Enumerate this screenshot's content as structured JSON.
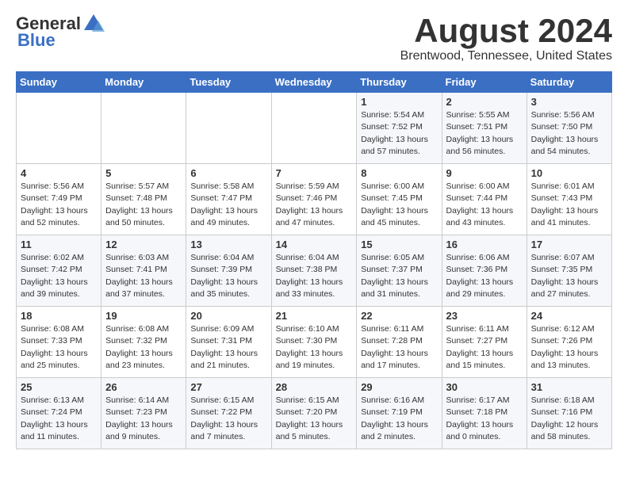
{
  "logo": {
    "general": "General",
    "blue": "Blue"
  },
  "header": {
    "title": "August 2024",
    "subtitle": "Brentwood, Tennessee, United States"
  },
  "weekdays": [
    "Sunday",
    "Monday",
    "Tuesday",
    "Wednesday",
    "Thursday",
    "Friday",
    "Saturday"
  ],
  "weeks": [
    [
      {
        "day": "",
        "detail": ""
      },
      {
        "day": "",
        "detail": ""
      },
      {
        "day": "",
        "detail": ""
      },
      {
        "day": "",
        "detail": ""
      },
      {
        "day": "1",
        "detail": "Sunrise: 5:54 AM\nSunset: 7:52 PM\nDaylight: 13 hours\nand 57 minutes."
      },
      {
        "day": "2",
        "detail": "Sunrise: 5:55 AM\nSunset: 7:51 PM\nDaylight: 13 hours\nand 56 minutes."
      },
      {
        "day": "3",
        "detail": "Sunrise: 5:56 AM\nSunset: 7:50 PM\nDaylight: 13 hours\nand 54 minutes."
      }
    ],
    [
      {
        "day": "4",
        "detail": "Sunrise: 5:56 AM\nSunset: 7:49 PM\nDaylight: 13 hours\nand 52 minutes."
      },
      {
        "day": "5",
        "detail": "Sunrise: 5:57 AM\nSunset: 7:48 PM\nDaylight: 13 hours\nand 50 minutes."
      },
      {
        "day": "6",
        "detail": "Sunrise: 5:58 AM\nSunset: 7:47 PM\nDaylight: 13 hours\nand 49 minutes."
      },
      {
        "day": "7",
        "detail": "Sunrise: 5:59 AM\nSunset: 7:46 PM\nDaylight: 13 hours\nand 47 minutes."
      },
      {
        "day": "8",
        "detail": "Sunrise: 6:00 AM\nSunset: 7:45 PM\nDaylight: 13 hours\nand 45 minutes."
      },
      {
        "day": "9",
        "detail": "Sunrise: 6:00 AM\nSunset: 7:44 PM\nDaylight: 13 hours\nand 43 minutes."
      },
      {
        "day": "10",
        "detail": "Sunrise: 6:01 AM\nSunset: 7:43 PM\nDaylight: 13 hours\nand 41 minutes."
      }
    ],
    [
      {
        "day": "11",
        "detail": "Sunrise: 6:02 AM\nSunset: 7:42 PM\nDaylight: 13 hours\nand 39 minutes."
      },
      {
        "day": "12",
        "detail": "Sunrise: 6:03 AM\nSunset: 7:41 PM\nDaylight: 13 hours\nand 37 minutes."
      },
      {
        "day": "13",
        "detail": "Sunrise: 6:04 AM\nSunset: 7:39 PM\nDaylight: 13 hours\nand 35 minutes."
      },
      {
        "day": "14",
        "detail": "Sunrise: 6:04 AM\nSunset: 7:38 PM\nDaylight: 13 hours\nand 33 minutes."
      },
      {
        "day": "15",
        "detail": "Sunrise: 6:05 AM\nSunset: 7:37 PM\nDaylight: 13 hours\nand 31 minutes."
      },
      {
        "day": "16",
        "detail": "Sunrise: 6:06 AM\nSunset: 7:36 PM\nDaylight: 13 hours\nand 29 minutes."
      },
      {
        "day": "17",
        "detail": "Sunrise: 6:07 AM\nSunset: 7:35 PM\nDaylight: 13 hours\nand 27 minutes."
      }
    ],
    [
      {
        "day": "18",
        "detail": "Sunrise: 6:08 AM\nSunset: 7:33 PM\nDaylight: 13 hours\nand 25 minutes."
      },
      {
        "day": "19",
        "detail": "Sunrise: 6:08 AM\nSunset: 7:32 PM\nDaylight: 13 hours\nand 23 minutes."
      },
      {
        "day": "20",
        "detail": "Sunrise: 6:09 AM\nSunset: 7:31 PM\nDaylight: 13 hours\nand 21 minutes."
      },
      {
        "day": "21",
        "detail": "Sunrise: 6:10 AM\nSunset: 7:30 PM\nDaylight: 13 hours\nand 19 minutes."
      },
      {
        "day": "22",
        "detail": "Sunrise: 6:11 AM\nSunset: 7:28 PM\nDaylight: 13 hours\nand 17 minutes."
      },
      {
        "day": "23",
        "detail": "Sunrise: 6:11 AM\nSunset: 7:27 PM\nDaylight: 13 hours\nand 15 minutes."
      },
      {
        "day": "24",
        "detail": "Sunrise: 6:12 AM\nSunset: 7:26 PM\nDaylight: 13 hours\nand 13 minutes."
      }
    ],
    [
      {
        "day": "25",
        "detail": "Sunrise: 6:13 AM\nSunset: 7:24 PM\nDaylight: 13 hours\nand 11 minutes."
      },
      {
        "day": "26",
        "detail": "Sunrise: 6:14 AM\nSunset: 7:23 PM\nDaylight: 13 hours\nand 9 minutes."
      },
      {
        "day": "27",
        "detail": "Sunrise: 6:15 AM\nSunset: 7:22 PM\nDaylight: 13 hours\nand 7 minutes."
      },
      {
        "day": "28",
        "detail": "Sunrise: 6:15 AM\nSunset: 7:20 PM\nDaylight: 13 hours\nand 5 minutes."
      },
      {
        "day": "29",
        "detail": "Sunrise: 6:16 AM\nSunset: 7:19 PM\nDaylight: 13 hours\nand 2 minutes."
      },
      {
        "day": "30",
        "detail": "Sunrise: 6:17 AM\nSunset: 7:18 PM\nDaylight: 13 hours\nand 0 minutes."
      },
      {
        "day": "31",
        "detail": "Sunrise: 6:18 AM\nSunset: 7:16 PM\nDaylight: 12 hours\nand 58 minutes."
      }
    ]
  ]
}
